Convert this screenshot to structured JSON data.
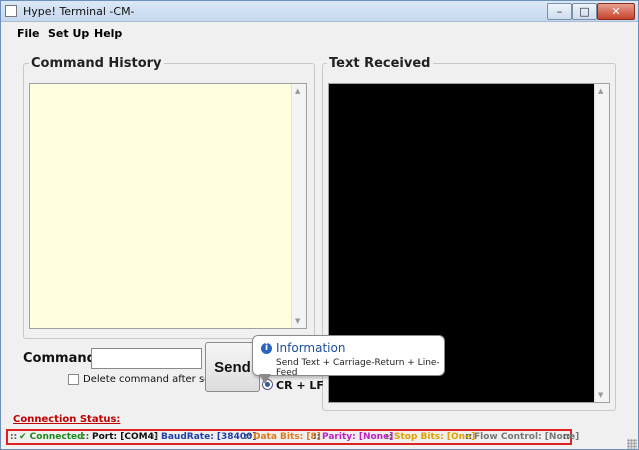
{
  "window": {
    "title": "Hype! Terminal -CM-",
    "minimize_glyph": "–",
    "maximize_glyph": "□",
    "close_glyph": "✕"
  },
  "menu": {
    "items": [
      "File",
      "Set Up",
      "Help"
    ]
  },
  "command_history": {
    "label": "Command History"
  },
  "text_received": {
    "label": "Text Received"
  },
  "command": {
    "label": "Command:",
    "value": ""
  },
  "delete_after_send": {
    "label": "Delete command after send",
    "checked": false
  },
  "send": {
    "label": "Send"
  },
  "line_ending": {
    "label": "CR + LF",
    "selected": true
  },
  "tooltip": {
    "icon": "info-icon",
    "title": "Information",
    "body": "Send Text + Carriage-Return + Line-Feed"
  },
  "connection": {
    "label": "Connection Status:",
    "separator": "::",
    "items": [
      {
        "text": "✔ Connected",
        "color": "#1a8c1a"
      },
      {
        "text": "Port: [COM4]",
        "color": "#111111"
      },
      {
        "text": "BaudRate: [38400]",
        "color": "#1f3fa8"
      },
      {
        "text": "Data Bits: [8]",
        "color": "#e0791b"
      },
      {
        "text": "Parity: [None]",
        "color": "#c020c0"
      },
      {
        "text": "Stop Bits: [One]",
        "color": "#e0a000"
      },
      {
        "text": "Flow Control: [None]",
        "color": "#777777"
      }
    ]
  }
}
